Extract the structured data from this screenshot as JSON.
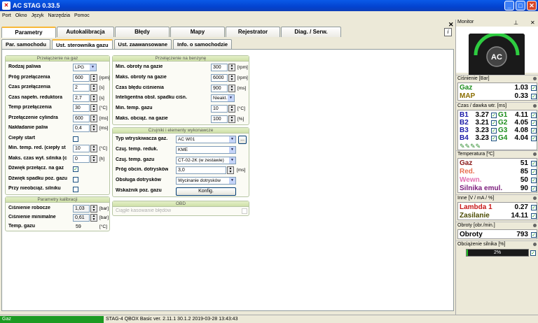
{
  "window": {
    "title": "AC STAG 0.33.5",
    "controls": {
      "minimize": "_",
      "maximize": "□",
      "close": "✕"
    }
  },
  "menu": [
    "Port",
    "Okno",
    "Język",
    "Narzędzia",
    "Pomoc"
  ],
  "tabs": [
    "Parametry",
    "Autokalibracja",
    "Błędy",
    "Mapy",
    "Rejestrator",
    "Diag. / Serw."
  ],
  "subtabs": [
    "Par. samochodu",
    "Ust. sterownika gazu",
    "Ust. zaawansowane",
    "Info. o samochodzie"
  ],
  "gas_switch": {
    "title": "Przełączenie na gaz",
    "rows": [
      {
        "label": "Rodzaj paliwa",
        "type": "dd",
        "value": "LPG"
      },
      {
        "label": "Próg przełączenia",
        "type": "spin",
        "value": "600",
        "unit": "[rpm]"
      },
      {
        "label": "Czas przełączenia",
        "type": "spin",
        "value": "2",
        "unit": "[s]"
      },
      {
        "label": "Czas napełn. reduktora",
        "type": "spin",
        "value": "2,7",
        "unit": "[s]"
      },
      {
        "label": "Temp przełączenia",
        "type": "spin",
        "value": "30",
        "unit": "[°C]"
      },
      {
        "label": "Przełączenie cylindra",
        "type": "spin",
        "value": "600",
        "unit": "[ms]"
      },
      {
        "label": "Nakładanie paliw",
        "type": "spin",
        "value": "0,4",
        "unit": "[ms]"
      },
      {
        "label": "Ciepły start",
        "type": "chk",
        "value": ""
      },
      {
        "label": "Min. temp. red. (ciepły st",
        "type": "spin",
        "value": "10",
        "unit": "[°C]"
      },
      {
        "label": "Maks. czas wył. silnika (c",
        "type": "spin",
        "value": "0",
        "unit": "[h]"
      },
      {
        "label": "Dźwięk przełącz. na gaz",
        "type": "chk",
        "value": "✓"
      },
      {
        "label": "Dźwięk spadku poz. gazu",
        "type": "chk",
        "value": ""
      },
      {
        "label": "Przy nieobciąż. silniku",
        "type": "chk",
        "value": ""
      }
    ]
  },
  "calib": {
    "title": "Parametry kalibracji",
    "rows": [
      {
        "label": "Ciśnienie robocze",
        "value": "1,03",
        "unit": "[bar]"
      },
      {
        "label": "Ciśnienie minimalne",
        "value": "0,61",
        "unit": "[bar]"
      },
      {
        "label": "Temp. gazu",
        "value": "59",
        "unit": "[°C]"
      }
    ]
  },
  "petrol": {
    "title": "Przełączenie na benzynę",
    "rows": [
      {
        "label": "Min. obroty na gazie",
        "type": "spin",
        "value": "300",
        "unit": "[rpm]"
      },
      {
        "label": "Maks. obroty na gazie",
        "type": "spin",
        "value": "6000",
        "unit": "[rpm]"
      },
      {
        "label": "Czas błędu ciśnienia",
        "type": "spin",
        "value": "900",
        "unit": "[ms]"
      },
      {
        "label": "Inteligentna obsł. spadku ciśn.",
        "type": "dd",
        "value": "Nieakt."
      },
      {
        "label": "Min. temp. gazu",
        "type": "spin",
        "value": "10",
        "unit": "[°C]"
      },
      {
        "label": "Maks. obciąż. na gazie",
        "type": "spin",
        "value": "100",
        "unit": "[%]"
      }
    ]
  },
  "sensors": {
    "title": "Czujniki i elementy wykonawcze",
    "rows": [
      {
        "label": "Typ wtryskiwacza gaz.",
        "value": "AC W01"
      },
      {
        "label": "Czuj. temp. reduk.",
        "value": "KME"
      },
      {
        "label": "Czuj. temp. gazu",
        "value": "CT-02-2K (w zestawie)"
      },
      {
        "label": "Próg obcin. dotrysków",
        "value": "3,0",
        "unit": "[ms]"
      },
      {
        "label": "Obsługa dotrysków",
        "value": "Wycinanie dotrysków"
      },
      {
        "label": "Wskaźnik poz. gazu",
        "value": "Konfig."
      }
    ],
    "browse": "..."
  },
  "obd": {
    "title": "OBD",
    "label": "Ciągłe kasowanie błędów"
  },
  "monitor": {
    "title": "Monitor",
    "pressure": {
      "title": "Ciśnienie [Bar]",
      "rows": [
        {
          "name": "Gaz",
          "value": "1.03",
          "color": "#1c8c1c"
        },
        {
          "name": "MAP",
          "value": "0.33",
          "color": "#8a6d00"
        }
      ]
    },
    "injection": {
      "title": "Czas / dawka wtr. [ms]",
      "rows": [
        {
          "b": "B1",
          "bv": "3.27",
          "g": "G1",
          "gv": "4.11"
        },
        {
          "b": "B2",
          "bv": "3.21",
          "g": "G2",
          "gv": "4.05"
        },
        {
          "b": "B3",
          "bv": "3.23",
          "g": "G3",
          "gv": "4.08"
        },
        {
          "b": "B4",
          "bv": "3.23",
          "g": "G4",
          "gv": "4.04"
        }
      ]
    },
    "temp": {
      "title": "Temperatura [ºC]",
      "rows": [
        {
          "name": "Gaz",
          "value": "51",
          "color": "#8a1a1a"
        },
        {
          "name": "Red.",
          "value": "85",
          "color": "#e87050"
        },
        {
          "name": "Wewn.",
          "value": "50",
          "color": "#e070b0"
        },
        {
          "name": "Silnika emul.",
          "value": "90",
          "color": "#7a1a7a"
        }
      ]
    },
    "other": {
      "title": "Inne [V / mA / %]",
      "rows": [
        {
          "name": "Lambda 1",
          "value": "0.27",
          "color": "#c81818"
        },
        {
          "name": "Zasilanie",
          "value": "14.11",
          "color": "#4a4a00"
        }
      ]
    },
    "rpm": {
      "title": "Obroty [obr./min.]",
      "name": "Obroty",
      "value": "793"
    },
    "load": {
      "title": "Obciążenie silnika [%]",
      "value": "2%",
      "fraction": 0.02
    }
  },
  "status": {
    "left": "Gaz",
    "text": "STAG-4 QBOX Basic  ver. 2.11.1  30.1.2   2019-03-28 13:43:43"
  }
}
